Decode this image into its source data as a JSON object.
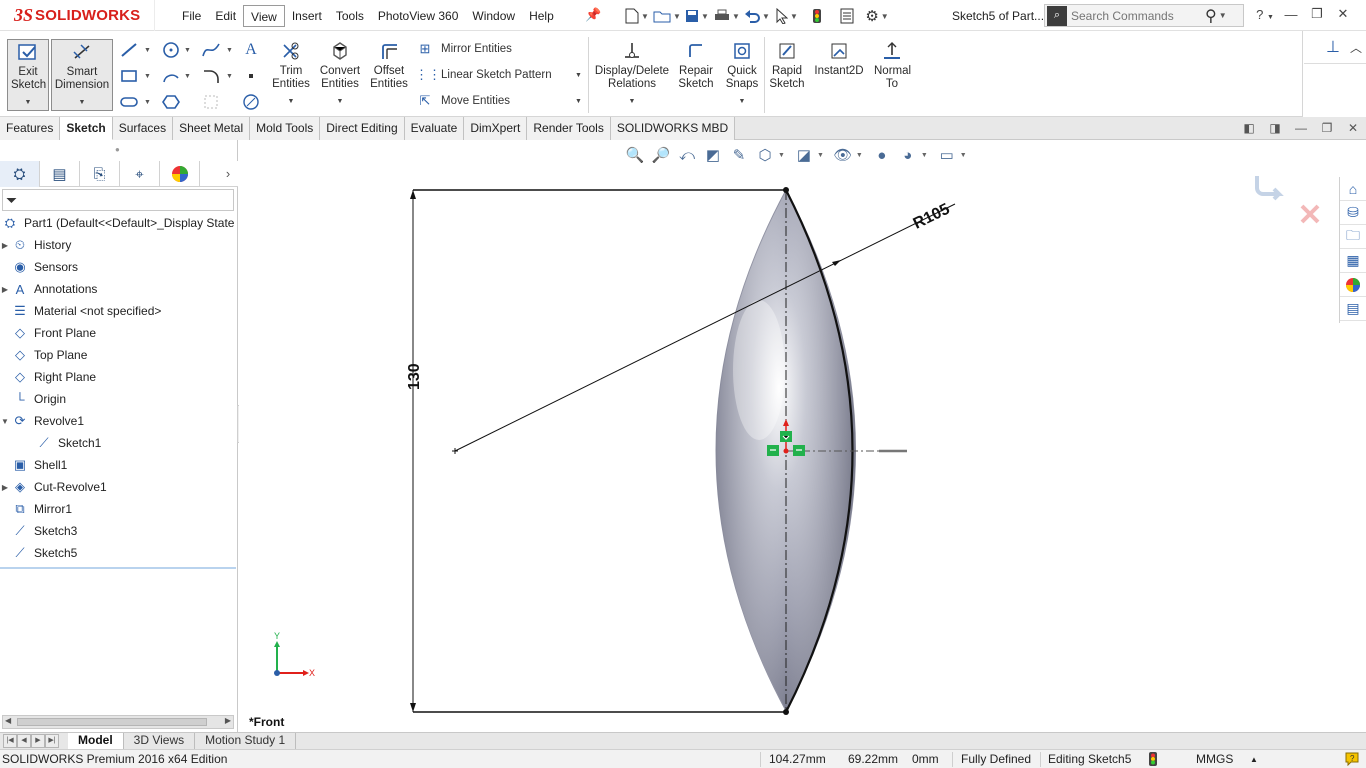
{
  "app": {
    "logo_prefix": "3S",
    "logo_name": "SOLIDWORKS",
    "doc_title": "Sketch5 of Part...",
    "search_placeholder": "Search Commands"
  },
  "menus": [
    "File",
    "Edit",
    "View",
    "Insert",
    "Tools",
    "PhotoView 360",
    "Window",
    "Help"
  ],
  "active_menu": "View",
  "quick_access_icons": [
    "new-document-icon",
    "open-folder-icon",
    "save-icon",
    "print-icon",
    "undo-icon",
    "select-pointer-icon",
    "rebuild-traffic-light-icon",
    "file-properties-icon",
    "options-gear-icon"
  ],
  "commands": {
    "exit_sketch": "Exit Sketch",
    "smart_dimension": "Smart Dimension",
    "trim_entities": "Trim Entities",
    "convert_entities": "Convert Entities",
    "offset_entities": "Offset Entities",
    "mirror_entities": "Mirror Entities",
    "linear_pattern": "Linear Sketch Pattern",
    "move_entities": "Move Entities",
    "display_relations": "Display/Delete Relations",
    "repair_sketch": "Repair Sketch",
    "quick_snaps": "Quick Snaps",
    "rapid_sketch": "Rapid Sketch",
    "instant2d": "Instant2D",
    "normal_to": "Normal To"
  },
  "tabs": [
    "Features",
    "Sketch",
    "Surfaces",
    "Sheet Metal",
    "Mold Tools",
    "Direct Editing",
    "Evaluate",
    "DimXpert",
    "Render Tools",
    "SOLIDWORKS MBD"
  ],
  "active_tab": "Sketch",
  "feature_tree": {
    "root": "Part1  (Default<<Default>_Display State",
    "items": [
      {
        "label": "History",
        "icon": "history-icon",
        "expandable": true
      },
      {
        "label": "Sensors",
        "icon": "sensors-icon",
        "expandable": false
      },
      {
        "label": "Annotations",
        "icon": "annotations-icon",
        "expandable": true
      },
      {
        "label": "Material <not specified>",
        "icon": "material-icon",
        "expandable": false
      },
      {
        "label": "Front Plane",
        "icon": "plane-icon",
        "expandable": false
      },
      {
        "label": "Top Plane",
        "icon": "plane-icon",
        "expandable": false
      },
      {
        "label": "Right Plane",
        "icon": "plane-icon",
        "expandable": false
      },
      {
        "label": "Origin",
        "icon": "origin-icon",
        "expandable": false
      },
      {
        "label": "Revolve1",
        "icon": "revolve-icon",
        "expandable": true,
        "expanded": true
      },
      {
        "label": "Sketch1",
        "icon": "sketch-icon",
        "expandable": false,
        "child": true
      },
      {
        "label": "Shell1",
        "icon": "shell-icon",
        "expandable": false
      },
      {
        "label": "Cut-Revolve1",
        "icon": "cut-revolve-icon",
        "expandable": true
      },
      {
        "label": "Mirror1",
        "icon": "mirror-icon",
        "expandable": false
      },
      {
        "label": "Sketch3",
        "icon": "sketch-icon",
        "expandable": false
      },
      {
        "label": "Sketch5",
        "icon": "sketch-icon",
        "expandable": false
      }
    ]
  },
  "viewport": {
    "dimension_height": "130",
    "dimension_radius": "R105",
    "view_name": "*Front",
    "triad_x": "X",
    "triad_y": "Y"
  },
  "bottom_tabs": [
    "Model",
    "3D Views",
    "Motion Study 1"
  ],
  "active_bottom_tab": "Model",
  "status": {
    "product": "SOLIDWORKS Premium 2016 x64 Edition",
    "x": "104.27mm",
    "y": "69.22mm",
    "z": "0mm",
    "definition": "Fully Defined",
    "editing": "Editing Sketch5",
    "units": "MMGS"
  },
  "colors": {
    "brand_red": "#d8201b",
    "icon_blue": "#2a5ea8",
    "origin_green": "#22b14c",
    "origin_red": "#e0201b"
  }
}
